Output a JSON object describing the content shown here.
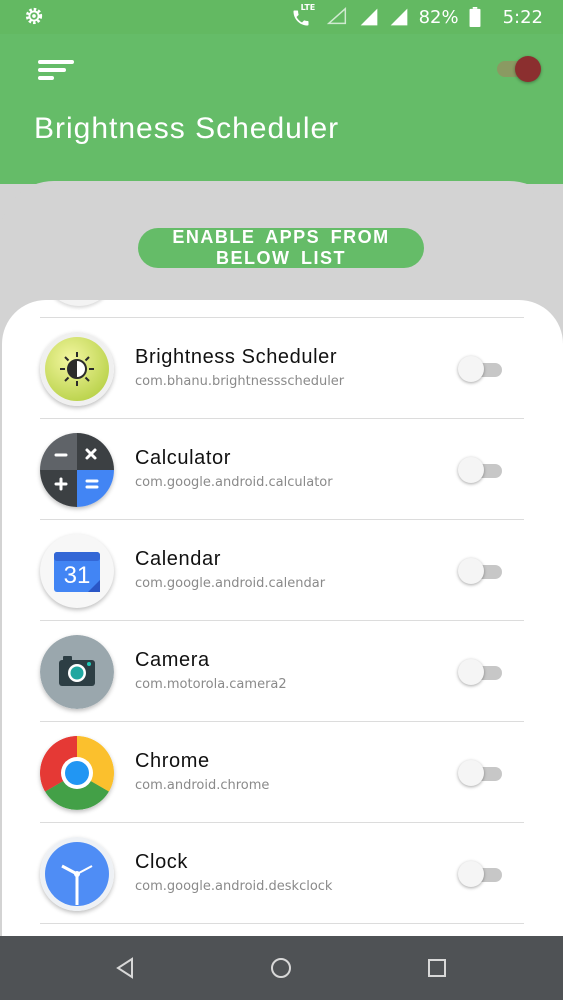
{
  "status_bar": {
    "network_label": "LTE",
    "battery_percent": "82%",
    "time": "5:22"
  },
  "header": {
    "title": "Brightness Scheduler",
    "master_toggle_on": true
  },
  "enable_button_label": "ENABLE APPS FROM BELOW LIST",
  "apps": [
    {
      "name": "Brightness Scheduler",
      "package": "com.bhanu.brightnessscheduler",
      "icon": "brightness-scheduler-icon",
      "enabled": false
    },
    {
      "name": "Calculator",
      "package": "com.google.android.calculator",
      "icon": "calculator-icon",
      "enabled": false
    },
    {
      "name": "Calendar",
      "package": "com.google.android.calendar",
      "icon": "calendar-icon",
      "icon_text": "31",
      "enabled": false
    },
    {
      "name": "Camera",
      "package": "com.motorola.camera2",
      "icon": "camera-icon",
      "enabled": false
    },
    {
      "name": "Chrome",
      "package": "com.android.chrome",
      "icon": "chrome-icon",
      "enabled": false
    },
    {
      "name": "Clock",
      "package": "com.google.android.deskclock",
      "icon": "clock-icon",
      "enabled": false
    }
  ],
  "colors": {
    "primary": "#65bc68",
    "master_toggle_thumb": "#8b2f2f",
    "nav_bar": "#4f5255"
  }
}
